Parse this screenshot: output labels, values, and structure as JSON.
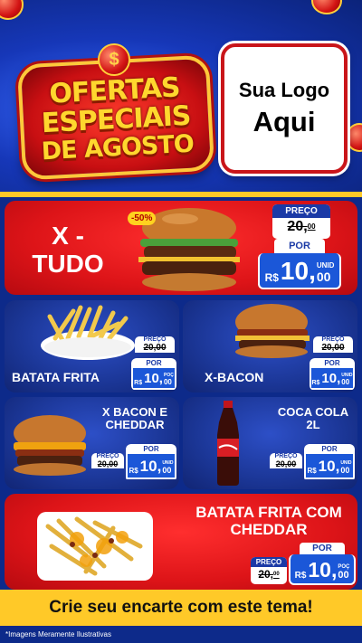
{
  "header": {
    "title_lines": [
      "OFERTAS",
      "ESPECIAIS",
      "DE AGOSTO"
    ],
    "dollar_symbol": "$",
    "logo_line1": "Sua Logo",
    "logo_line2": "Aqui"
  },
  "products": [
    {
      "name_l1": "X -",
      "name_l2": "TUDO",
      "discount": "-50%",
      "old_label": "PREÇO",
      "old_price": "20,",
      "old_cents": "00",
      "new_label": "POR",
      "currency": "R$",
      "new_price": "10,",
      "new_cents": "00",
      "unit": "UNID"
    },
    {
      "name": "BATATA FRITA",
      "old_label": "PREÇO",
      "old_price": "20,00",
      "new_label": "POR",
      "currency": "R$",
      "new_price": "10,",
      "new_cents": "00",
      "unit": "POÇ"
    },
    {
      "name": "X-BACON",
      "old_label": "PREÇO",
      "old_price": "20,00",
      "new_label": "POR",
      "currency": "R$",
      "new_price": "10,",
      "new_cents": "00",
      "unit": "UNID"
    },
    {
      "name_l1": "X BACON E",
      "name_l2": "CHEDDAR",
      "old_label": "PREÇO",
      "old_price": "20,00",
      "new_label": "POR",
      "currency": "R$",
      "new_price": "10,",
      "new_cents": "00",
      "unit": "UNID"
    },
    {
      "name_l1": "COCA COLA",
      "name_l2": "2L",
      "old_label": "PREÇO",
      "old_price": "20,00",
      "new_label": "POR",
      "currency": "R$",
      "new_price": "10,",
      "new_cents": "00",
      "unit": "UNID"
    },
    {
      "name_l1": "BATATA FRITA COM",
      "name_l2": "CHEDDAR",
      "old_label": "PREÇO",
      "old_price": "20,",
      "old_cents": "00",
      "new_label": "POR",
      "currency": "R$",
      "new_price": "10,",
      "new_cents": "00",
      "unit": "POÇ"
    }
  ],
  "footer": {
    "cta": "Crie seu encarte com este tema!",
    "disclaimer": "*Imagens Meramente Ilustrativas"
  },
  "colors": {
    "red": "#dd1418",
    "blue": "#1b3696",
    "yellow": "#ffc928",
    "price_blue": "#1b57d8"
  }
}
